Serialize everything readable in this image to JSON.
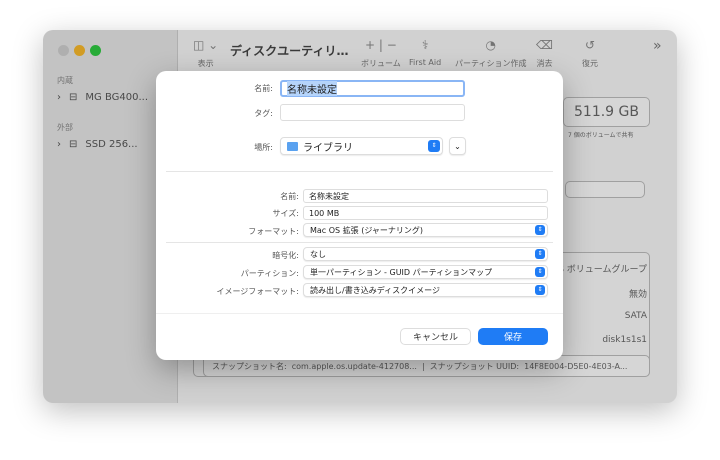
{
  "window": {
    "title": "ディスクユーティリ…",
    "toolbar": [
      {
        "icon": "sidebar-icon",
        "label": "表示"
      },
      {
        "icon": "plus-minus-icon",
        "label": "ボリューム"
      },
      {
        "icon": "stethoscope-icon",
        "label": "First Aid"
      },
      {
        "icon": "pie-icon",
        "label": "パーティション作成"
      },
      {
        "icon": "erase-icon",
        "label": "消去"
      },
      {
        "icon": "restore-icon",
        "label": "復元"
      }
    ],
    "sidebar": {
      "internal": "内蔵",
      "internal_item": "MG BG400...",
      "external": "外部",
      "external_item": "SSD 256..."
    },
    "capacity": "511.9 GB",
    "capacity_note": "7 個のボリュームで共有",
    "info": [
      "S ボリュームグループ",
      "無効",
      "SATA",
      "disk1s1s1"
    ],
    "snapshot_name_label": "スナップショット名:",
    "snapshot_name": "com.apple.os.update-412708...",
    "snapshot_uuid_label": "スナップショット UUID:",
    "snapshot_uuid": "14F8E004-D5E0-4E03-A..."
  },
  "dialog": {
    "name_label": "名前:",
    "name_value": "名称未設定",
    "tag_label": "タグ:",
    "tag_value": "",
    "where_label": "場所:",
    "where_value": "ライブラリ",
    "image_name_label": "名前:",
    "image_name_value": "名称未設定",
    "size_label": "サイズ:",
    "size_value": "100 MB",
    "format_label": "フォーマット:",
    "format_value": "Mac OS 拡張 (ジャーナリング)",
    "encryption_label": "暗号化:",
    "encryption_value": "なし",
    "partition_label": "パーティション:",
    "partition_value": "単一パーティション - GUID パーティションマップ",
    "image_format_label": "イメージフォーマット:",
    "image_format_value": "読み出し/書き込みディスクイメージ",
    "cancel": "キャンセル",
    "save": "保存"
  },
  "colors": {
    "accent": "#1f7cf5"
  }
}
